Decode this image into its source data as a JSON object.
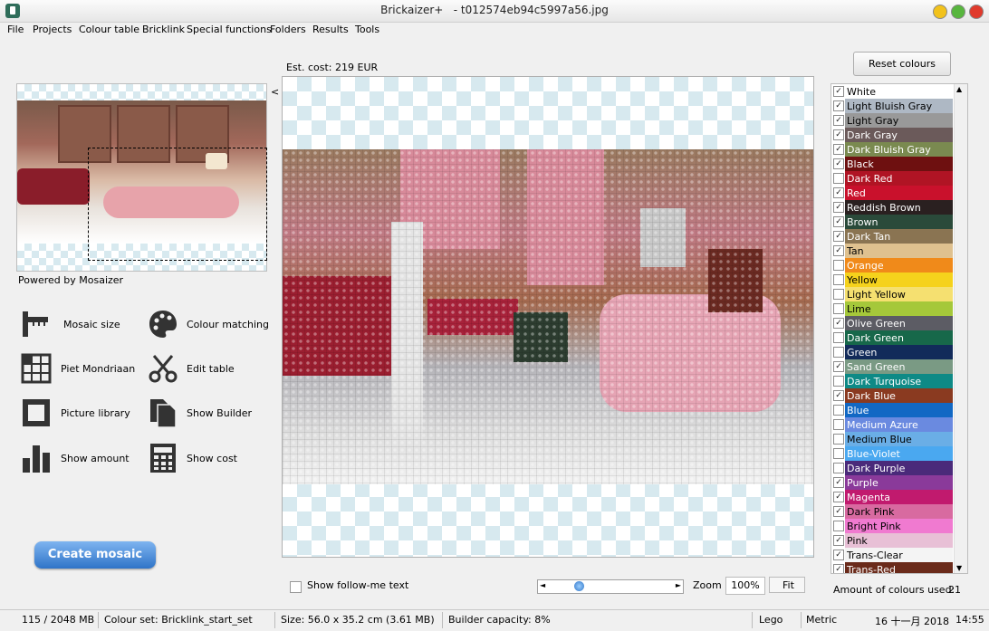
{
  "window": {
    "app_name": "Brickaizer+",
    "file_name": "- t012574eb94c5997a56.jpg",
    "controls": {
      "minimize_color": "#f2c21b",
      "maximize_color": "#58b63e",
      "close_color": "#e03a2c"
    }
  },
  "menu": [
    "File",
    "Projects",
    "Colour table",
    "Bricklink",
    "Special functions",
    "Folders",
    "Results",
    "Tools"
  ],
  "left_panel": {
    "collapse_glyph": "<",
    "powered_by": "Powered by Mosaizer",
    "tools": [
      {
        "label": "Mosaic size",
        "icon": "ruler-icon"
      },
      {
        "label": "Colour matching",
        "icon": "palette-icon"
      },
      {
        "label": "Piet Mondriaan",
        "icon": "grid-icon"
      },
      {
        "label": "Edit table",
        "icon": "scissors-icon"
      },
      {
        "label": "Picture library",
        "icon": "frame-icon"
      },
      {
        "label": "Show Builder",
        "icon": "documents-icon"
      },
      {
        "label": "Show amount",
        "icon": "bar-chart-icon"
      },
      {
        "label": "Show cost",
        "icon": "calculator-icon"
      }
    ],
    "create_button": "Create mosaic"
  },
  "center": {
    "est_cost": "Est. cost: 219 EUR",
    "follow_me_label": "Show follow-me text",
    "slider_left": "◄",
    "slider_right": "►",
    "zoom_label": "Zoom",
    "zoom_value": "100%",
    "fit_label": "Fit"
  },
  "right_panel": {
    "reset_button": "Reset colours",
    "colours": [
      {
        "name": "White",
        "checked": true,
        "color": "#ffffff",
        "text": "#000000"
      },
      {
        "name": "Light Bluish Gray",
        "checked": true,
        "color": "#aeb8c4",
        "text": "#000000"
      },
      {
        "name": "Light Gray",
        "checked": true,
        "color": "#999999",
        "text": "#000000"
      },
      {
        "name": "Dark Gray",
        "checked": true,
        "color": "#6b5a5a",
        "text": "#ffffff"
      },
      {
        "name": "Dark Bluish Gray",
        "checked": true,
        "color": "#7a8a50",
        "text": "#ffffff"
      },
      {
        "name": "Black",
        "checked": true,
        "color": "#6e1010",
        "text": "#ffffff"
      },
      {
        "name": "Dark Red",
        "checked": false,
        "color": "#b01424",
        "text": "#ffffff"
      },
      {
        "name": "Red",
        "checked": true,
        "color": "#c9112c",
        "text": "#ffffff"
      },
      {
        "name": "Reddish Brown",
        "checked": true,
        "color": "#2a2020",
        "text": "#ffffff"
      },
      {
        "name": "Brown",
        "checked": true,
        "color": "#2a4a3a",
        "text": "#ffffff"
      },
      {
        "name": "Dark Tan",
        "checked": true,
        "color": "#8a7452",
        "text": "#ffffff"
      },
      {
        "name": "Tan",
        "checked": true,
        "color": "#dfc18f",
        "text": "#000000"
      },
      {
        "name": "Orange",
        "checked": false,
        "color": "#f08a1a",
        "text": "#ffffff"
      },
      {
        "name": "Yellow",
        "checked": false,
        "color": "#f5d21c",
        "text": "#000000"
      },
      {
        "name": "Light Yellow",
        "checked": false,
        "color": "#f5e070",
        "text": "#000000"
      },
      {
        "name": "Lime",
        "checked": false,
        "color": "#a5c83a",
        "text": "#000000"
      },
      {
        "name": "Olive Green",
        "checked": true,
        "color": "#5c5c64",
        "text": "#ffffff"
      },
      {
        "name": "Dark Green",
        "checked": false,
        "color": "#17684a",
        "text": "#ffffff"
      },
      {
        "name": "Green",
        "checked": false,
        "color": "#122b5a",
        "text": "#ffffff"
      },
      {
        "name": "Sand Green",
        "checked": true,
        "color": "#7a9a84",
        "text": "#ffffff"
      },
      {
        "name": "Dark Turquoise",
        "checked": false,
        "color": "#0e8a86",
        "text": "#ffffff"
      },
      {
        "name": "Dark Blue",
        "checked": true,
        "color": "#8a3a20",
        "text": "#ffffff"
      },
      {
        "name": "Blue",
        "checked": false,
        "color": "#1268c4",
        "text": "#ffffff"
      },
      {
        "name": "Medium Azure",
        "checked": false,
        "color": "#6a8ae0",
        "text": "#ffffff"
      },
      {
        "name": "Medium Blue",
        "checked": false,
        "color": "#6aaee6",
        "text": "#000000"
      },
      {
        "name": "Blue-Violet",
        "checked": false,
        "color": "#4aa8f0",
        "text": "#ffffff"
      },
      {
        "name": "Dark Purple",
        "checked": false,
        "color": "#4a2a7a",
        "text": "#ffffff"
      },
      {
        "name": "Purple",
        "checked": true,
        "color": "#8a3a9a",
        "text": "#ffffff"
      },
      {
        "name": "Magenta",
        "checked": true,
        "color": "#c11a6e",
        "text": "#ffffff"
      },
      {
        "name": "Dark Pink",
        "checked": true,
        "color": "#d86aa0",
        "text": "#000000"
      },
      {
        "name": "Bright Pink",
        "checked": false,
        "color": "#f07ad0",
        "text": "#000000"
      },
      {
        "name": "Pink",
        "checked": true,
        "color": "#e8c0d6",
        "text": "#000000"
      },
      {
        "name": "Trans-Clear",
        "checked": true,
        "color": "#f4f4f4",
        "text": "#000000"
      },
      {
        "name": "Trans-Red",
        "checked": true,
        "color": "#6a2a1a",
        "text": "#ffffff"
      }
    ],
    "check_glyph": "✓",
    "amount_label": "Amount of colours used:",
    "amount_value": "21"
  },
  "status_bar": {
    "memory": "115 / 2048 MB",
    "colour_set": "Colour set: Bricklink_start_set",
    "size": "Size: 56.0 x 35.2 cm (3.61 MB)",
    "builder_capacity": "Builder capacity: 8%",
    "brand": "Lego",
    "units": "Metric",
    "date": "16 十一月 2018",
    "time": "14:55"
  }
}
